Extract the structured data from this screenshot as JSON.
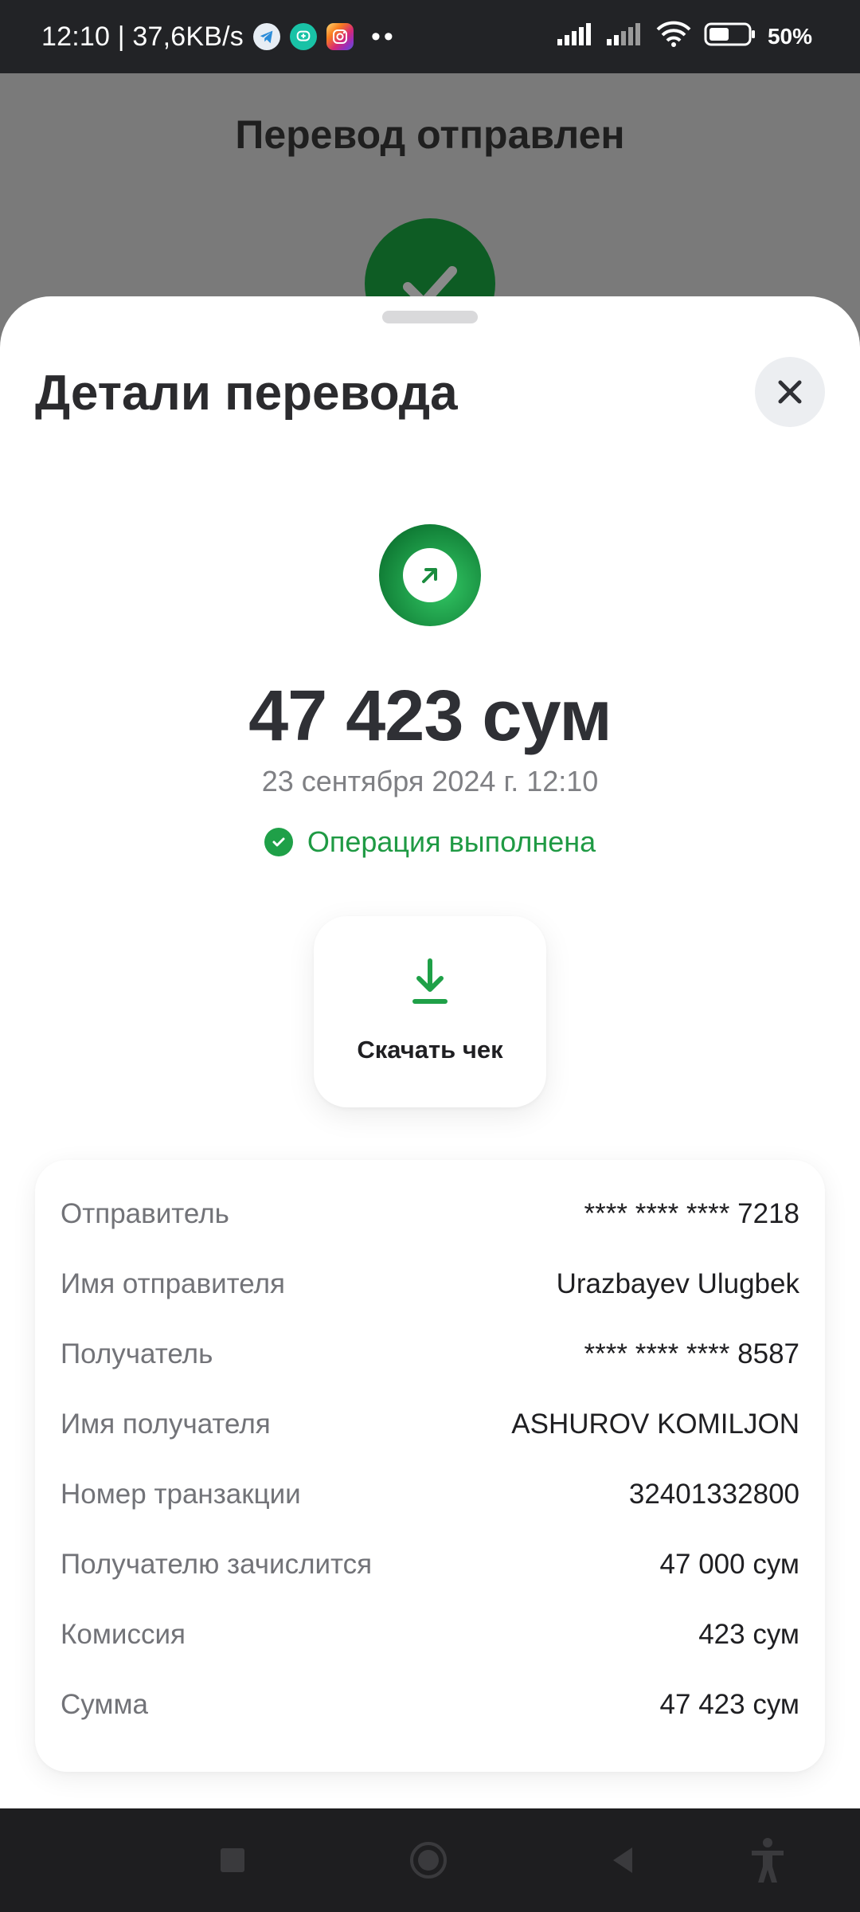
{
  "status_bar": {
    "time_net": "12:10 | 37,6KB/s",
    "battery": "50%",
    "icons": [
      "telegram-icon",
      "message-app-icon",
      "instagram-icon",
      "signal-icon",
      "signal-icon-2",
      "wifi-icon",
      "battery-icon"
    ],
    "more_dots": "••"
  },
  "background_page": {
    "title": "Перевод отправлен"
  },
  "sheet": {
    "title": "Детали перевода",
    "amount": "47 423 сум",
    "datetime": "23 сентября 2024 г. 12:10",
    "status": "Операция выполнена",
    "download_label": "Скачать чек",
    "accent_color": "#1fa048"
  },
  "details": [
    {
      "label": "Отправитель",
      "value": "**** **** **** 7218"
    },
    {
      "label": "Имя отправителя",
      "value": "Urazbayev Ulugbek"
    },
    {
      "label": "Получатель",
      "value": "**** **** **** 8587"
    },
    {
      "label": "Имя получателя",
      "value": "ASHUROV KOMILJON"
    },
    {
      "label": "Номер транзакции",
      "value": "32401332800"
    },
    {
      "label": "Получателю зачислится",
      "value": "47 000 сум"
    },
    {
      "label": "Комиссия",
      "value": "423 сум"
    },
    {
      "label": "Сумма",
      "value": "47 423 сум"
    }
  ]
}
